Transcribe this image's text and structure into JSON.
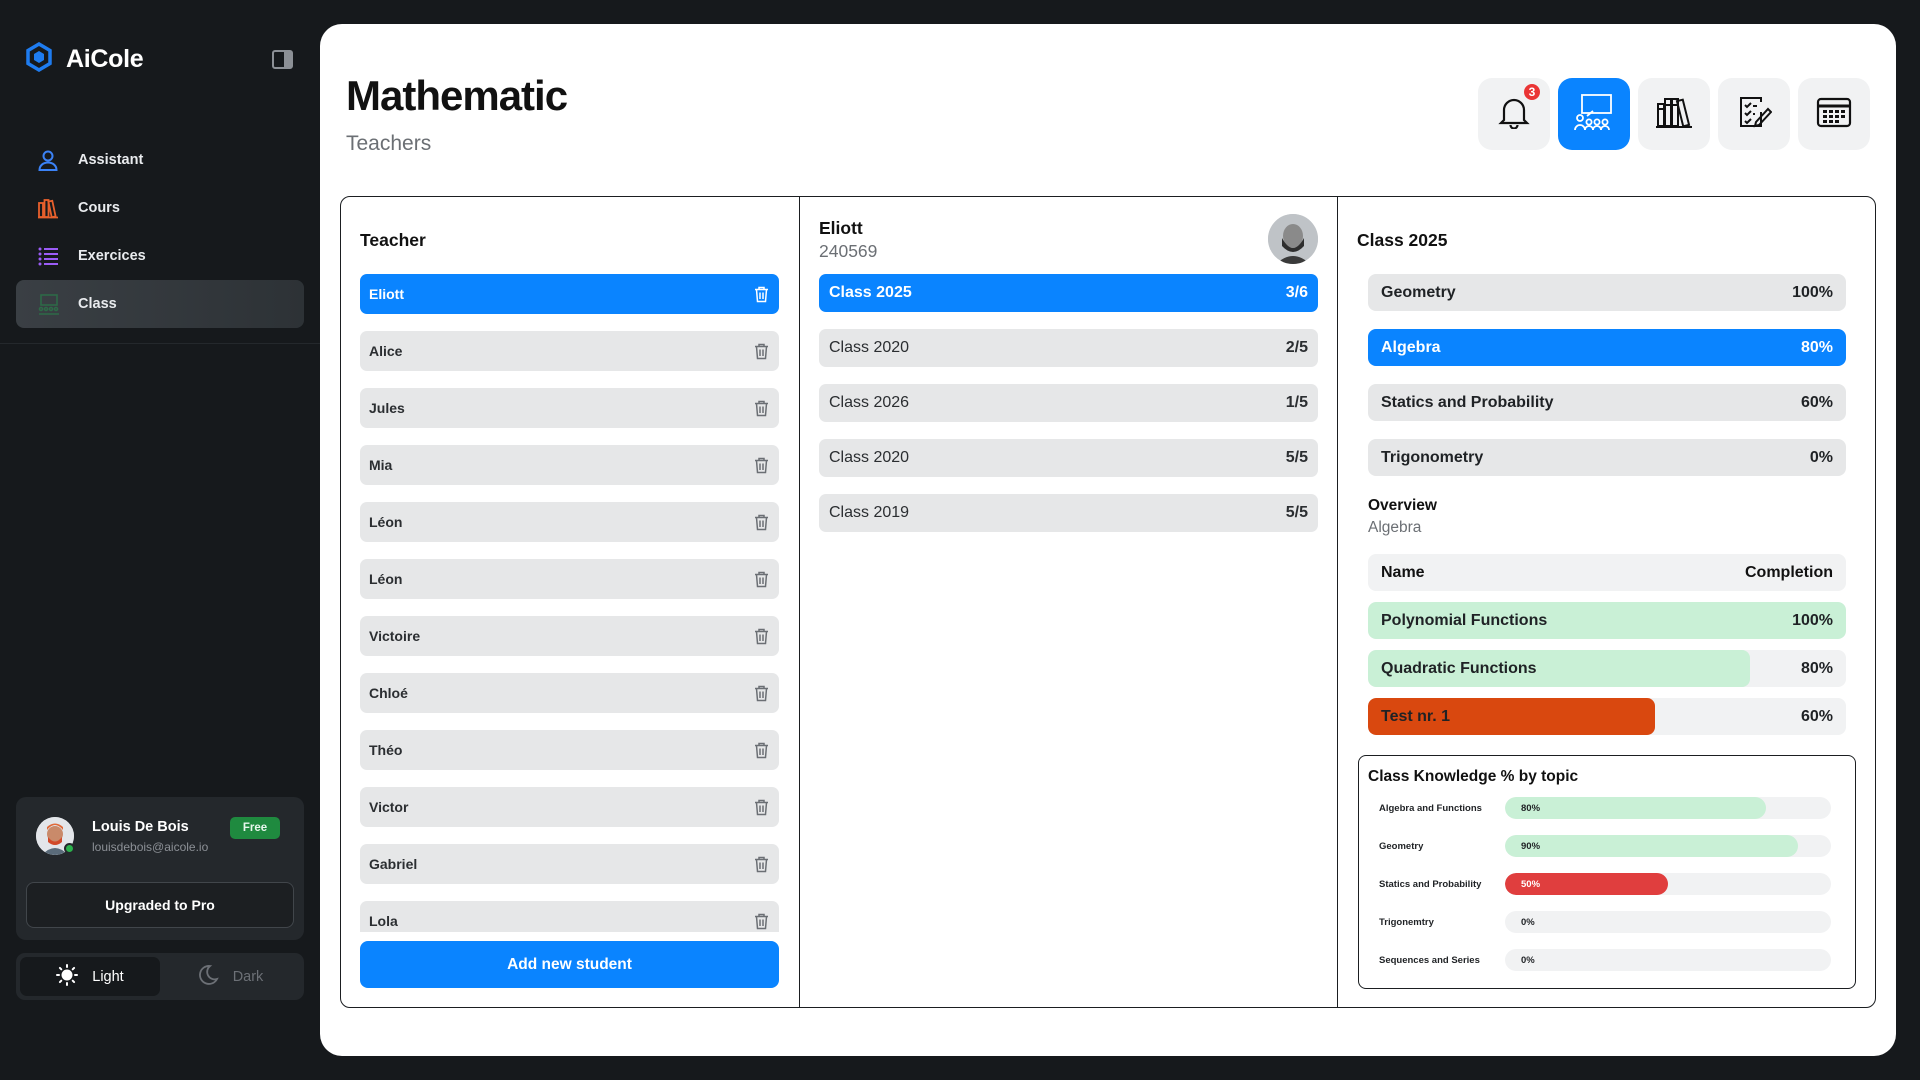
{
  "app": {
    "name": "AiCole"
  },
  "sidebar": {
    "items": [
      {
        "label": "Assistant",
        "icon": "user-icon",
        "color": "#3b82f6"
      },
      {
        "label": "Cours",
        "icon": "books-icon",
        "color": "#e8602c"
      },
      {
        "label": "Exercices",
        "icon": "list-icon",
        "color": "#9b5cf6"
      },
      {
        "label": "Class",
        "icon": "classroom-icon",
        "color": "#2d6a47",
        "active": true
      }
    ],
    "user": {
      "name": "Louis De Bois",
      "email": "louisdebois@aicole.io",
      "plan": "Free",
      "upgrade_label": "Upgraded to Pro"
    },
    "theme": {
      "light_label": "Light",
      "dark_label": "Dark"
    }
  },
  "header": {
    "title": "Mathematic",
    "subtitle": "Teachers",
    "notifications_count": "3",
    "toolbar": [
      "bell-icon",
      "classroom-icon",
      "library-icon",
      "tasks-icon",
      "calendar-icon"
    ]
  },
  "teachers": {
    "title": "Teacher",
    "list": [
      {
        "name": "Eliott",
        "active": true
      },
      {
        "name": "Alice"
      },
      {
        "name": "Jules"
      },
      {
        "name": "Mia"
      },
      {
        "name": "Léon"
      },
      {
        "name": "Léon"
      },
      {
        "name": "Victoire"
      },
      {
        "name": "Chloé"
      },
      {
        "name": "Théo"
      },
      {
        "name": "Victor"
      },
      {
        "name": "Gabriel"
      },
      {
        "name": "Lola"
      }
    ],
    "add_label": "Add new student"
  },
  "selected_teacher": {
    "name": "Eliott",
    "id": "240569",
    "classes": [
      {
        "name": "Class 2025",
        "count": "3/6",
        "active": true
      },
      {
        "name": "Class 2020",
        "count": "2/5"
      },
      {
        "name": "Class 2026",
        "count": "1/5"
      },
      {
        "name": "Class 2020",
        "count": "5/5"
      },
      {
        "name": "Class 2019",
        "count": "5/5"
      }
    ]
  },
  "class_detail": {
    "title": "Class 2025",
    "subjects": [
      {
        "name": "Geometry",
        "value": "100%"
      },
      {
        "name": "Algebra",
        "value": "80%",
        "active": true
      },
      {
        "name": "Statics and Probability",
        "value": "60%"
      },
      {
        "name": "Trigonometry",
        "value": "0%"
      }
    ],
    "overview": {
      "title": "Overview",
      "subtitle": "Algebra",
      "col_name": "Name",
      "col_completion": "Completion",
      "rows": [
        {
          "name": "Polynomial Functions",
          "value": "100%",
          "fraction": 1.0,
          "color": "#c9f0d6"
        },
        {
          "name": "Quadratic Functions",
          "value": "80%",
          "fraction": 0.8,
          "color": "#c9f0d6"
        },
        {
          "name": "Test nr. 1",
          "value": "60%",
          "fraction": 0.6,
          "color": "#d9480f"
        }
      ]
    },
    "knowledge": {
      "title": "Class Knowledge % by topic",
      "rows": [
        {
          "label": "Algebra and Functions",
          "value": "80%",
          "fraction": 0.8,
          "color": "#c9f0d6"
        },
        {
          "label": "Geometry",
          "value": "90%",
          "fraction": 0.9,
          "color": "#c9f0d6"
        },
        {
          "label": "Statics and Probability",
          "value": "50%",
          "fraction": 0.5,
          "color": "#e03e3e"
        },
        {
          "label": "Trigonemtry",
          "value": "0%",
          "fraction": 0,
          "color": "#c9f0d6"
        },
        {
          "label": "Sequences and Series",
          "value": "0%",
          "fraction": 0,
          "color": "#c9f0d6"
        }
      ]
    }
  }
}
